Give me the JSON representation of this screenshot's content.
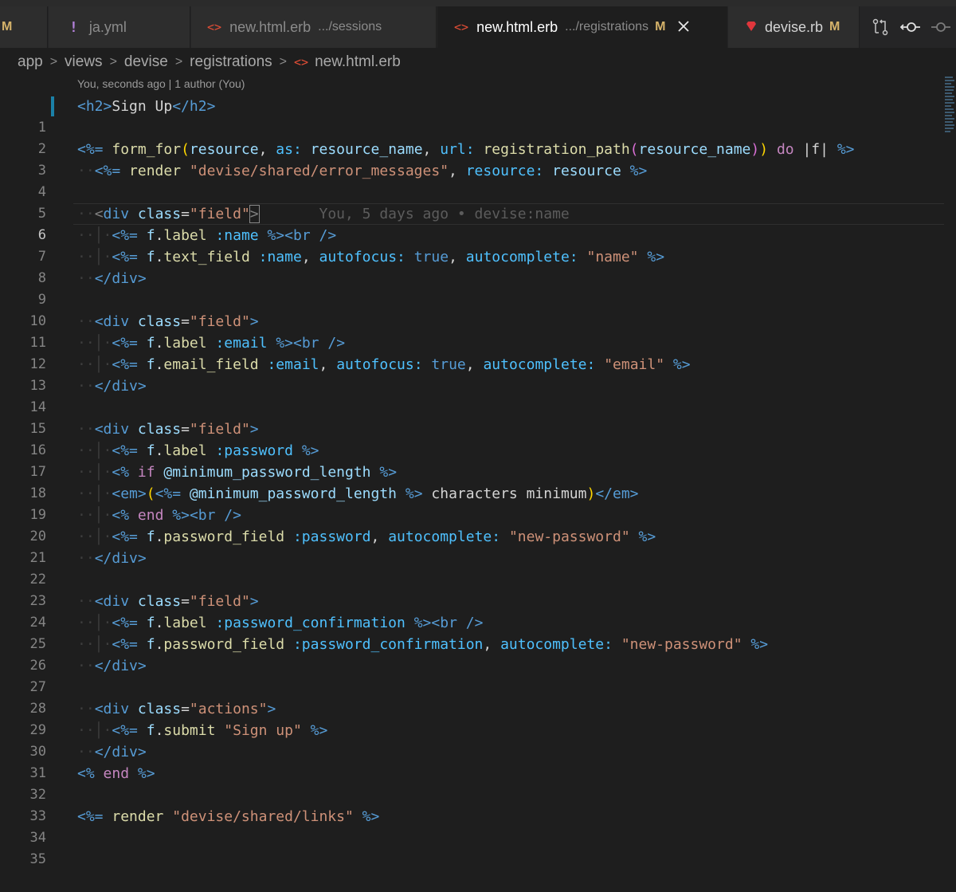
{
  "tabs": [
    {
      "icon": "M",
      "label": "",
      "desc": "",
      "mod": ""
    },
    {
      "icon": "!",
      "label": "ja.yml",
      "desc": "",
      "mod": ""
    },
    {
      "icon": "<>",
      "label": "new.html.erb",
      "desc": ".../sessions",
      "mod": ""
    },
    {
      "icon": "<>",
      "label": "new.html.erb",
      "desc": ".../registrations",
      "mod": "M"
    },
    {
      "icon": "",
      "label": "devise.rb",
      "desc": "",
      "mod": "M"
    }
  ],
  "breadcrumb": [
    "app",
    "views",
    "devise",
    "registrations",
    "new.html.erb"
  ],
  "blame_header": "You, seconds ago | 1 author (You)",
  "blame_inline": "You, 5 days ago • devise:name",
  "line_numbers": [
    "1",
    "2",
    "3",
    "4",
    "5",
    "6",
    "7",
    "8",
    "9",
    "10",
    "11",
    "12",
    "13",
    "14",
    "15",
    "16",
    "17",
    "18",
    "19",
    "20",
    "21",
    "22",
    "23",
    "24",
    "25",
    "26",
    "27",
    "28",
    "29",
    "30",
    "31",
    "32",
    "33",
    "34",
    "35"
  ],
  "t": {
    "h2o": "<h2>",
    "h2text": "Sign Up",
    "h2c": "</h2>",
    "erbEq": "<%=",
    "erb": "<%",
    "erbC": "%>",
    "form_for": "form_for",
    "resource": "resource",
    "as_kw": "as:",
    "resource_name": "resource_name",
    "url_kw": "url:",
    "registration_path": "registration_path",
    "do": "do",
    "bar_f": "|f|",
    "render": "render",
    "error_messages": "\"devise/shared/error_messages\"",
    "resource_kw": "resource:",
    "divo": "<div",
    "class": "class",
    "eq": "=",
    "field": "\"field\"",
    "gt": ">",
    "divc": "</div>",
    "f": "f",
    "label": "label",
    "text_field": "text_field",
    "email_field": "email_field",
    "password_field": "password_field",
    "submit": "submit",
    "dot": ".",
    "comma": ",",
    "lp": "(",
    "rp": ")",
    "sym_name": ":name",
    "sym_email": ":email",
    "sym_password": ":password",
    "sym_password_confirmation": ":password_confirmation",
    "br": "<br",
    "slash_gt": "/>",
    "autofocus": "autofocus:",
    "autocomplete": "autocomplete:",
    "true": "true",
    "str_name": "\"name\"",
    "str_email": "\"email\"",
    "str_new_password": "\"new-password\"",
    "if": "if",
    "end": "end",
    "min_len": "@minimum_password_length",
    "em_o": "<em>",
    "em_c": "</em>",
    "chars_min": "characters minimum",
    "actions": "\"actions\"",
    "sign_up": "\"Sign up\"",
    "links": "\"devise/shared/links\""
  }
}
